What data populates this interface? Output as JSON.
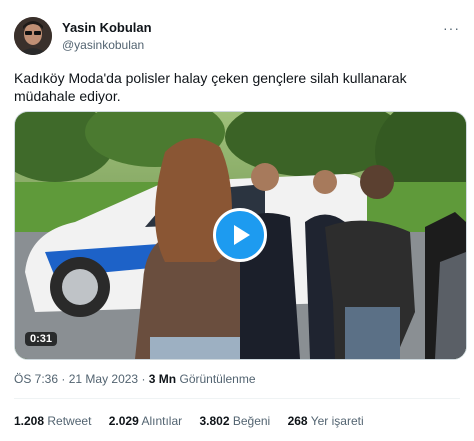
{
  "tweet": {
    "author_name": "Yasin Kobulan",
    "author_handle": "@yasinkobulan",
    "more_icon": "more-icon",
    "text": "Kadıköy Moda'da  polisler halay çeken gençlere silah kullanarak müdahale ediyor.",
    "video": {
      "duration": "0:31",
      "play_icon": "play-icon"
    },
    "time": "ÖS 7:36",
    "date": "21 May 2023",
    "views_count": "3 Mn",
    "views_label": "Görüntülenme",
    "stats": {
      "retweets_count": "1.208",
      "retweets_label": "Retweet",
      "quotes_count": "2.029",
      "quotes_label": "Alıntılar",
      "likes_count": "3.802",
      "likes_label": "Beğeni",
      "bookmarks_count": "268",
      "bookmarks_label": "Yer işareti"
    }
  }
}
